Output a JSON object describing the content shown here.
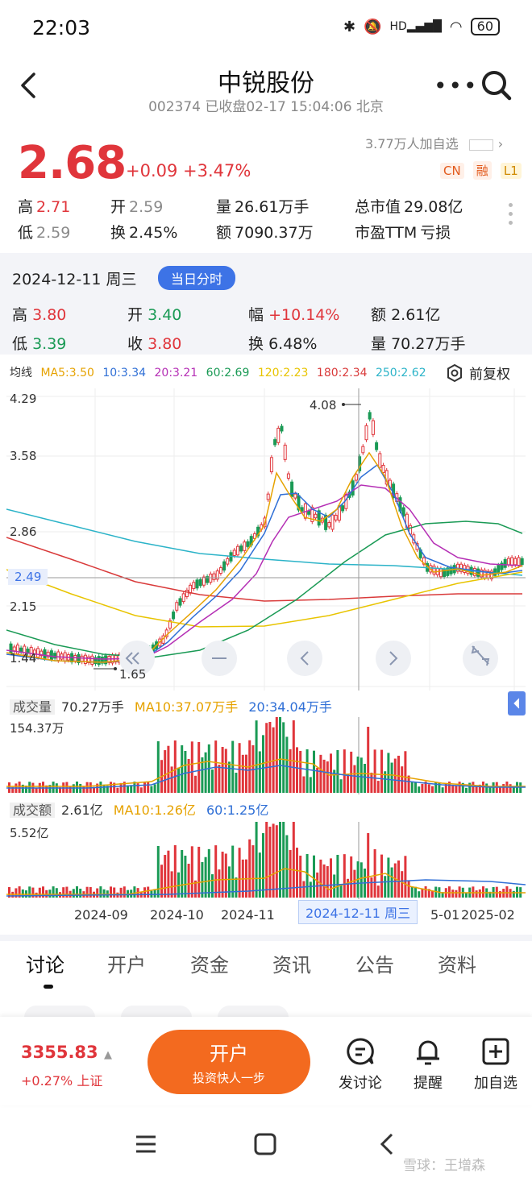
{
  "status": {
    "time": "22:03",
    "battery": "60",
    "hd": "HD"
  },
  "header": {
    "title": "中锐股份",
    "subtitle": "002374 已收盘02-17 15:04:06 北京"
  },
  "quote": {
    "price": "2.68",
    "change": "+0.09 +3.47%",
    "watchers": "3.77万人加自选",
    "tags": [
      "CN",
      "融",
      "L1"
    ],
    "high_label": "高",
    "high": "2.71",
    "open_label": "开",
    "open": "2.59",
    "vol_label": "量",
    "vol": "26.61万手",
    "mcap_label": "总市值",
    "mcap": "29.08亿",
    "low_label": "低",
    "low": "2.59",
    "turn_label": "换",
    "turn": "2.45%",
    "amt_label": "额",
    "amt": "7090.37万",
    "pe_label": "市盈TTM",
    "pe": "亏损"
  },
  "day": {
    "date": "2024-12-11 周三",
    "tab": "当日分时",
    "high_label": "高",
    "high": "3.80",
    "open_label": "开",
    "open": "3.40",
    "amp_label": "幅",
    "amp": "+10.14%",
    "amt_label": "额",
    "amt": "2.61亿",
    "low_label": "低",
    "low": "3.39",
    "close_label": "收",
    "close": "3.80",
    "turn_label": "换",
    "turn": "6.48%",
    "vol_label": "量",
    "vol": "70.27万手"
  },
  "ma": {
    "label": "均线",
    "items": [
      {
        "text": "MA5:3.50",
        "color": "#e6a200"
      },
      {
        "text": "10:3.34",
        "color": "#2f6fd6"
      },
      {
        "text": "20:3.21",
        "color": "#b52fb5"
      },
      {
        "text": "60:2.69",
        "color": "#1a9a55"
      },
      {
        "text": "120:2.23",
        "color": "#e8c400"
      },
      {
        "text": "180:2.34",
        "color": "#d93a3a"
      },
      {
        "text": "250:2.62",
        "color": "#2bb3c8"
      }
    ],
    "adj": "前复权"
  },
  "chart": {
    "y_labels": [
      "4.29",
      "3.58",
      "2.86",
      "2.15",
      "1.44"
    ],
    "cross_price": "2.49",
    "max_label": "4.08",
    "min_label": "1.65"
  },
  "volume": {
    "label": "成交量",
    "value": "70.27万手",
    "ma10": "MA10:37.07万手",
    "ma20": "20:34.04万手",
    "ymax": "154.37万"
  },
  "amount": {
    "label": "成交额",
    "value": "2.61亿",
    "ma10": "MA10:1.26亿",
    "ma60": "60:1.25亿",
    "ymax": "5.52亿"
  },
  "x_axis": [
    "2024-09",
    "2024-10",
    "2024-11",
    "5-01",
    "2025-02"
  ],
  "cross_date": "2024-12-11 周三",
  "tabs": [
    "讨论",
    "开户",
    "资金",
    "资讯",
    "公告",
    "资料"
  ],
  "bottom": {
    "index_value": "3355.83",
    "index_change": "+0.27% 上证",
    "open_l1": "开户",
    "open_l2": "投资快人一步",
    "discuss": "发讨论",
    "remind": "提醒",
    "watch": "加自选"
  },
  "watermark": "雪球：王增森"
}
